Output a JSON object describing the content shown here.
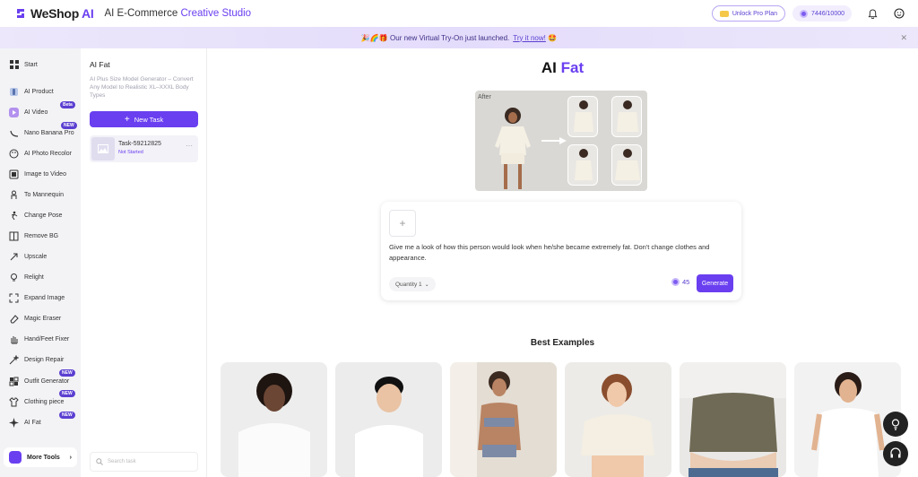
{
  "header": {
    "logo_we": "WeShop",
    "logo_ai": "AI",
    "studio_prefix": "AI E-Commerce",
    "studio_suffix": "Creative Studio",
    "pro_label": "Unlock Pro Plan",
    "credits": "7446/10000"
  },
  "banner": {
    "emoji": "🎉🌈🎁",
    "text": "Our new Virtual Try-On just launched.",
    "link": "Try it now!",
    "emoji_end": "🤩"
  },
  "sidebar": {
    "items": [
      {
        "label": "Start",
        "icon": "grid-icon"
      },
      {
        "label": "AI Product",
        "icon": "bottle-icon"
      },
      {
        "label": "AI Video",
        "icon": "video-icon",
        "badge": "Beta"
      },
      {
        "label": "Nano Banana Pro",
        "icon": "banana-icon",
        "badge": "NEW"
      },
      {
        "label": "AI Photo Recolor",
        "icon": "palette-icon"
      },
      {
        "label": "Image to Video",
        "icon": "film-icon"
      },
      {
        "label": "To Mannequin",
        "icon": "mannequin-icon"
      },
      {
        "label": "Change Pose",
        "icon": "pose-icon"
      },
      {
        "label": "Remove BG",
        "icon": "remove-bg-icon"
      },
      {
        "label": "Upscale",
        "icon": "upscale-icon"
      },
      {
        "label": "Relight",
        "icon": "bulb-icon"
      },
      {
        "label": "Expand Image",
        "icon": "expand-icon"
      },
      {
        "label": "Magic Eraser",
        "icon": "eraser-icon"
      },
      {
        "label": "Hand/Feet Fixer",
        "icon": "hand-icon"
      },
      {
        "label": "Design Repair",
        "icon": "wand-icon"
      },
      {
        "label": "Outfit Generator",
        "icon": "outfit-icon",
        "badge": "NEW"
      },
      {
        "label": "Clothing piece",
        "icon": "clothing-icon",
        "badge": "NEW"
      },
      {
        "label": "AI Fat",
        "icon": "sparkle-icon",
        "badge": "NEW"
      }
    ],
    "more_tools": "More Tools"
  },
  "panel": {
    "title": "AI Fat",
    "description": "AI Plus Size Model Generator – Convert Any Model to Realistic XL–XXXL Body Types",
    "new_task": "New Task",
    "task_name": "Task-59212825",
    "task_status": "Not Started",
    "search_placeholder": "Search task"
  },
  "main": {
    "title_ai": "AI",
    "title_fat": "Fat",
    "hero_label": "After",
    "prompt": "Give me a look of how this person would look when he/she became extremely fat. Don't change clothes and appearance.",
    "quantity": "Quantity 1",
    "cost": "45",
    "generate": "Generate",
    "examples_title": "Best Examples"
  },
  "colors": {
    "accent": "#6a3ff0",
    "sidebar_bg": "#f3f3f6",
    "banner_bg": "#e6defb"
  }
}
